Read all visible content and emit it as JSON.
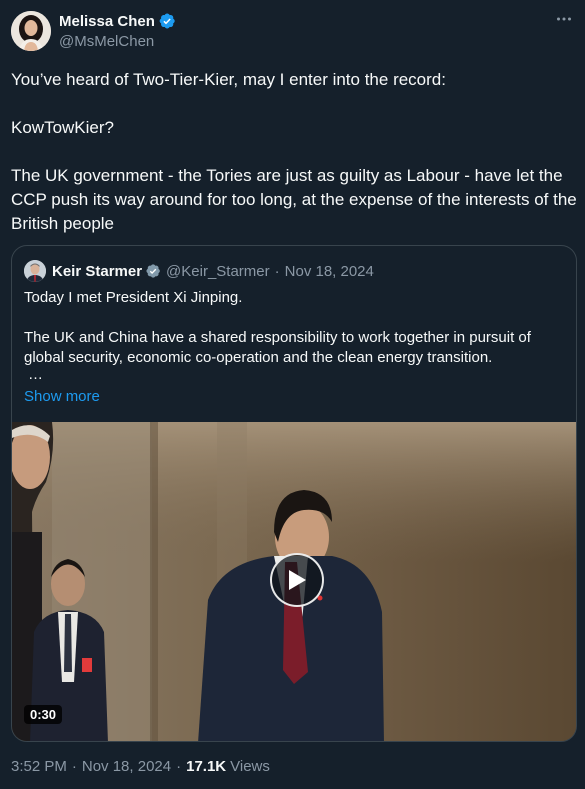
{
  "author": {
    "display_name": "Melissa Chen",
    "handle": "@MsMelChen"
  },
  "tweet": {
    "paragraphs": [
      "You’ve heard of Two-Tier-Kier, may I enter into the record:",
      "KowTowKier?",
      "The UK government - the Tories are just as guilty as Labour - have let the CCP push its way around for too long, at the expense of the interests of the British people"
    ]
  },
  "quote": {
    "display_name": "Keir Starmer",
    "handle": "@Keir_Starmer",
    "dot": "·",
    "date": "Nov 18, 2024",
    "paragraphs": [
      "Today I met President Xi Jinping.",
      "The UK and China have a shared responsibility to work together in pursuit of global security, economic co-operation and the clean energy transition."
    ],
    "ellipsis": "…",
    "show_more": "Show more",
    "video_duration": "0:30"
  },
  "footer": {
    "time": "3:52 PM",
    "dot": "·",
    "date": "Nov 18, 2024",
    "dot2": "·",
    "views_count": "17.1K",
    "views_label": "Views"
  },
  "colors": {
    "background": "#15202b",
    "accent": "#1d9bf0",
    "secondary_text": "#8b98a5",
    "border": "#38444d"
  },
  "icons": {
    "verified": "verified-badge-icon",
    "more": "more-options-icon",
    "play": "play-icon"
  }
}
